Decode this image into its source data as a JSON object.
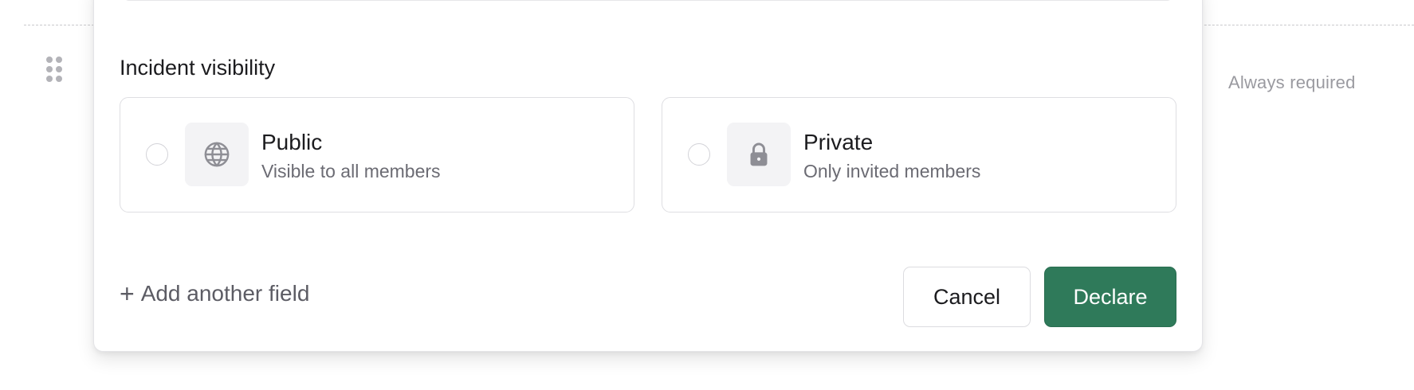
{
  "meta_side": {
    "always_required": "Always required"
  },
  "visibility": {
    "label": "Incident visibility",
    "options": [
      {
        "title": "Public",
        "description": "Visible to all members",
        "icon": "globe-icon",
        "selected": false
      },
      {
        "title": "Private",
        "description": "Only invited members",
        "icon": "lock-icon",
        "selected": false
      }
    ]
  },
  "footer": {
    "add_field_label": "Add another field",
    "cancel_label": "Cancel",
    "declare_label": "Declare"
  },
  "colors": {
    "primary": "#2f7a5a",
    "muted_text": "#6b6b73",
    "icon_gray": "#8e8e95"
  }
}
